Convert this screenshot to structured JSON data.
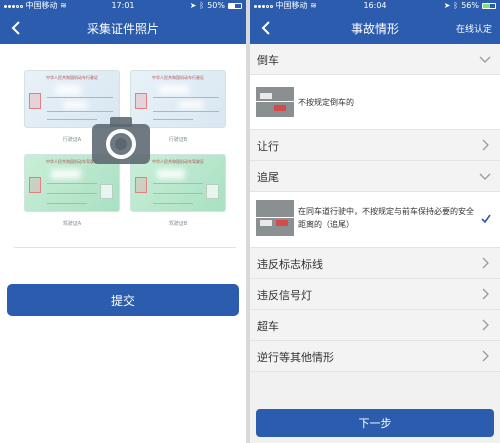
{
  "left_screen": {
    "status": {
      "carrier": "中国移动",
      "time": "17:01",
      "battery": "50%",
      "battery_level": 0.5
    },
    "header": {
      "title": "采集证件照片"
    },
    "cards": [
      {
        "heading": "中华人民共和国机动车行驶证",
        "caption": "行驶证A"
      },
      {
        "heading": "中华人民共和国机动车行驶证",
        "caption": "行驶证B"
      },
      {
        "heading": "中华人民共和国机动车驾驶证",
        "caption": "驾驶证A"
      },
      {
        "heading": "中华人民共和国机动车驾驶证",
        "caption": "驾驶证B"
      }
    ],
    "submit_label": "提交"
  },
  "right_screen": {
    "status": {
      "carrier": "中国移动",
      "time": "16:04",
      "battery": "56%",
      "battery_level": 0.56
    },
    "header": {
      "title": "事故情形",
      "action": "在线认定"
    },
    "sections": [
      {
        "label": "倒车",
        "expanded": true,
        "detail": "不按规定倒车的",
        "selected": false
      },
      {
        "label": "让行",
        "expanded": false
      },
      {
        "label": "追尾",
        "expanded": true,
        "detail": "在同车道行驶中，不按规定与前车保持必要的安全距离的（追尾）",
        "selected": true
      },
      {
        "label": "违反标志标线",
        "expanded": false
      },
      {
        "label": "违反信号灯",
        "expanded": false
      },
      {
        "label": "超车",
        "expanded": false
      },
      {
        "label": "逆行等其他情形",
        "expanded": false
      }
    ],
    "next_label": "下一步"
  }
}
